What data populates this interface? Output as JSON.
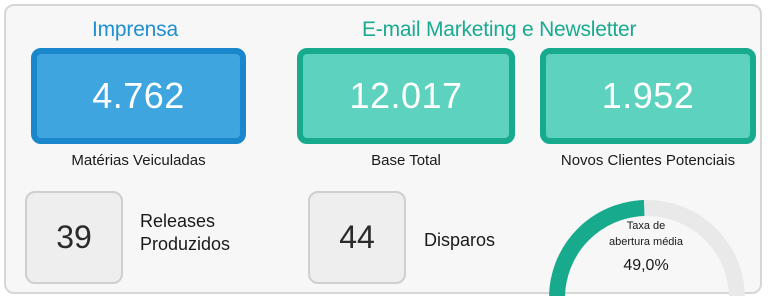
{
  "imprensa": {
    "title": "Imprensa",
    "materias": {
      "value": "4.762",
      "label": "Matérias Veiculadas"
    },
    "releases": {
      "value": "39",
      "label_line1": "Releases",
      "label_line2": "Produzidos"
    }
  },
  "email": {
    "title": "E-mail Marketing e Newsletter",
    "base": {
      "value": "12.017",
      "label": "Base Total"
    },
    "novos": {
      "value": "1.952",
      "label": "Novos Clientes Potenciais"
    },
    "disparos": {
      "value": "44",
      "label": "Disparos"
    },
    "taxa": {
      "label_line1": "Taxa de",
      "label_line2": "abertura média",
      "value": "49,0%",
      "fraction": 0.49
    }
  },
  "colors": {
    "blue_accent": "#1a86cc",
    "blue_fill": "#3ea5df",
    "green_accent": "#17aa8c",
    "green_fill": "#5dd3bf",
    "gauge_track": "#e9e9e9"
  }
}
